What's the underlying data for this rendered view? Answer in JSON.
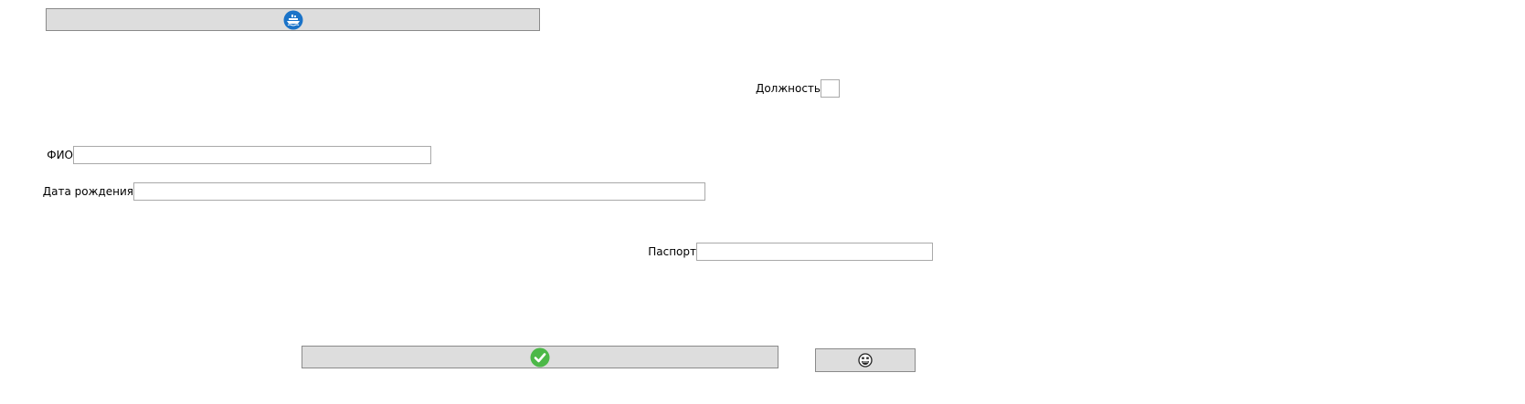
{
  "toolbar": {
    "top_button_icon": "ship-refresh-icon"
  },
  "form": {
    "position_label": "Должность",
    "position_value": "",
    "fio_label": "ФИО",
    "fio_value": "",
    "birthdate_label": "Дата рождения",
    "birthdate_value": "",
    "passport_label": "Паспорт",
    "passport_value": ""
  },
  "actions": {
    "confirm_icon": "check-circle-icon",
    "secondary_icon": "smiley-face-icon"
  },
  "colors": {
    "button_bg": "#dddddd",
    "button_border": "#8a8a8a",
    "accent_blue": "#1a73c8",
    "check_green": "#4cb848"
  }
}
